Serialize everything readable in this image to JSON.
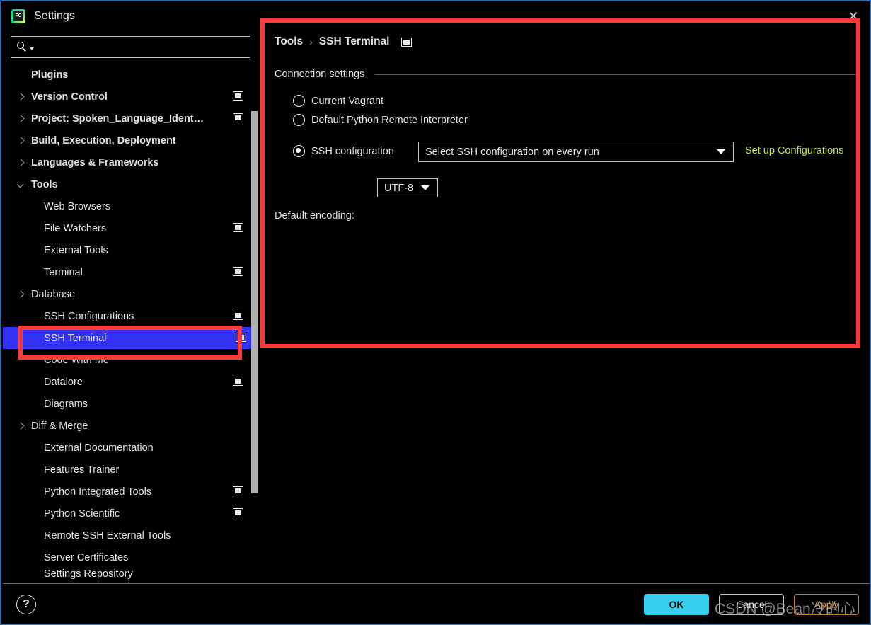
{
  "window": {
    "title": "Settings",
    "logo_icon": "pycharm-logo-icon",
    "close_icon": "✕"
  },
  "search": {
    "value": "",
    "placeholder": "",
    "icon": "search-icon"
  },
  "sidebar": {
    "items": [
      {
        "label": "Plugins",
        "level": "top",
        "chevron": "none",
        "badge": false
      },
      {
        "label": "Version Control",
        "level": "top",
        "chevron": "closed",
        "badge": true
      },
      {
        "label": "Project: Spoken_Language_Ident…",
        "level": "top",
        "chevron": "closed",
        "badge": true
      },
      {
        "label": "Build, Execution, Deployment",
        "level": "top",
        "chevron": "closed",
        "badge": false
      },
      {
        "label": "Languages & Frameworks",
        "level": "top",
        "chevron": "closed",
        "badge": false
      },
      {
        "label": "Tools",
        "level": "top",
        "chevron": "open",
        "badge": false
      },
      {
        "label": "Web Browsers",
        "level": "child",
        "chevron": "none",
        "badge": false
      },
      {
        "label": "File Watchers",
        "level": "child",
        "chevron": "none",
        "badge": true
      },
      {
        "label": "External Tools",
        "level": "child",
        "chevron": "none",
        "badge": false
      },
      {
        "label": "Terminal",
        "level": "child",
        "chevron": "none",
        "badge": true
      },
      {
        "label": "Database",
        "level": "child-exp",
        "chevron": "closed",
        "badge": false
      },
      {
        "label": "SSH Configurations",
        "level": "child",
        "chevron": "none",
        "badge": true
      },
      {
        "label": "SSH Terminal",
        "level": "child",
        "chevron": "none",
        "badge": true,
        "selected": true
      },
      {
        "label": "Code With Me",
        "level": "child",
        "chevron": "none",
        "badge": false
      },
      {
        "label": "Datalore",
        "level": "child",
        "chevron": "none",
        "badge": true
      },
      {
        "label": "Diagrams",
        "level": "child",
        "chevron": "none",
        "badge": false
      },
      {
        "label": "Diff & Merge",
        "level": "child-exp",
        "chevron": "closed",
        "badge": false
      },
      {
        "label": "External Documentation",
        "level": "child",
        "chevron": "none",
        "badge": false
      },
      {
        "label": "Features Trainer",
        "level": "child",
        "chevron": "none",
        "badge": false
      },
      {
        "label": "Python Integrated Tools",
        "level": "child",
        "chevron": "none",
        "badge": true
      },
      {
        "label": "Python Scientific",
        "level": "child",
        "chevron": "none",
        "badge": true
      },
      {
        "label": "Remote SSH External Tools",
        "level": "child",
        "chevron": "none",
        "badge": false
      },
      {
        "label": "Server Certificates",
        "level": "child",
        "chevron": "none",
        "badge": false
      },
      {
        "label": "Settings Repository",
        "level": "child",
        "chevron": "none",
        "badge": false,
        "clipped": true
      }
    ],
    "selected_index": 12
  },
  "main": {
    "breadcrumb": {
      "root": "Tools",
      "separator": "›",
      "current": "SSH Terminal"
    },
    "section_title": "Connection settings",
    "radios": [
      {
        "label": "Current Vagrant",
        "checked": false
      },
      {
        "label": "Default Python Remote Interpreter",
        "checked": false
      },
      {
        "label": "SSH configuration",
        "checked": true
      }
    ],
    "ssh_config_select": {
      "value": "Select SSH configuration on every run"
    },
    "setup_link": "Set up Configurations",
    "encoding_label": "Default encoding:",
    "encoding_select": {
      "value": "UTF-8"
    }
  },
  "footer": {
    "help_icon": "?",
    "ok_label": "OK",
    "cancel_label": "Cancel",
    "apply_label": "Apply",
    "watermark": "CSDN @Bean冷的心"
  },
  "colors": {
    "selection_blue": "#3333f5",
    "annotation_red": "#fc3a3a",
    "link_green": "#c5e84b",
    "ok_cyan": "#35d0ef",
    "apply_orange": "#e08a2e",
    "window_border": "#2c6fb5"
  }
}
